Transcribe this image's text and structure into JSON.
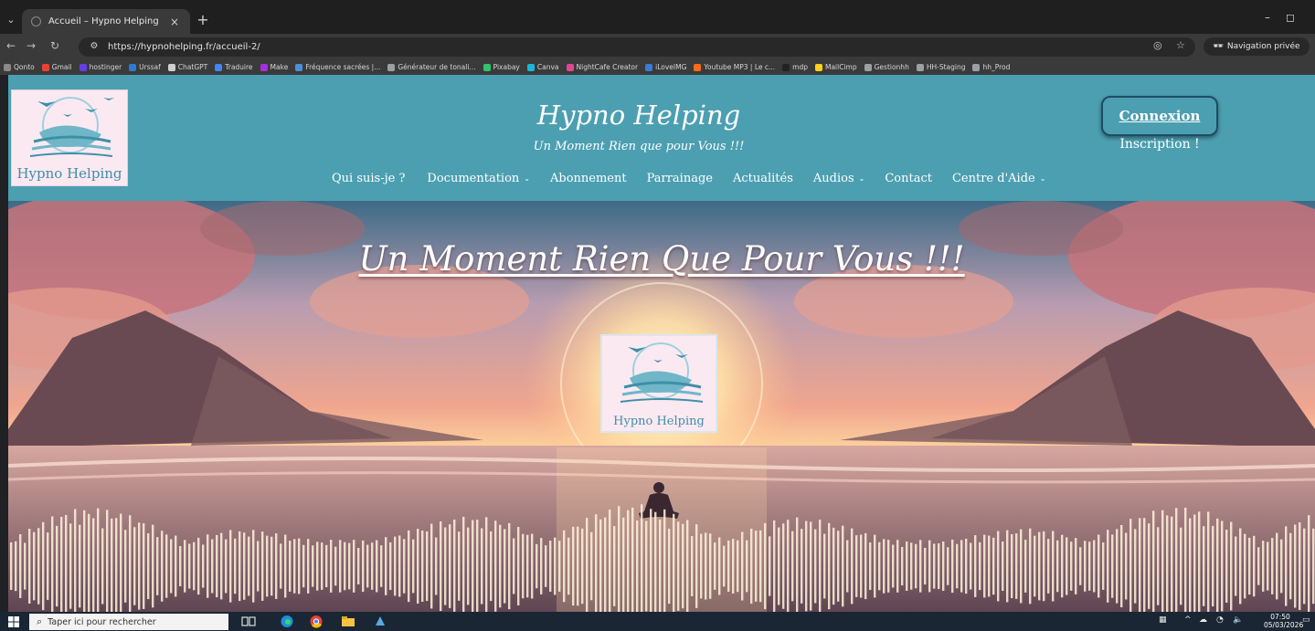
{
  "browser": {
    "tab_title": "Accueil – Hypno Helping",
    "tab_close": "×",
    "new_tab": "+",
    "url": "https://hypnohelping.fr/accueil-2/",
    "private_label": "Navigation privée",
    "minimize": "–",
    "restore": "◻",
    "bookmarks": [
      {
        "label": "Qonto",
        "color": "#8a8a8a"
      },
      {
        "label": "Gmail",
        "color": "#e94235"
      },
      {
        "label": "hostinger",
        "color": "#673de6"
      },
      {
        "label": "Urssaf",
        "color": "#2b7bd6"
      },
      {
        "label": "ChatGPT",
        "color": "#d0d0d0"
      },
      {
        "label": "Traduire",
        "color": "#4285f4"
      },
      {
        "label": "Make",
        "color": "#a62fe0"
      },
      {
        "label": "Fréquence sacrées |...",
        "color": "#4a90d9"
      },
      {
        "label": "Générateur de tonali...",
        "color": "#9aa0a6"
      },
      {
        "label": "Pixabay",
        "color": "#2ec66d"
      },
      {
        "label": "Canva",
        "color": "#19b7d6"
      },
      {
        "label": "NightCafe Creator",
        "color": "#e04595"
      },
      {
        "label": "iLoveIMG",
        "color": "#3a7bd5"
      },
      {
        "label": "Youtube MP3 | Le c...",
        "color": "#ff6a1a"
      },
      {
        "label": "mdp",
        "color": "#222222"
      },
      {
        "label": "MailCimp",
        "color": "#ffd21a"
      },
      {
        "label": "Gestionhh",
        "color": "#9aa0a6"
      },
      {
        "label": "HH-Staging",
        "color": "#9aa0a6"
      },
      {
        "label": "hh_Prod",
        "color": "#9aa0a6"
      }
    ]
  },
  "site": {
    "brand_title": "Hypno Helping",
    "brand_tagline": "Un Moment Rien que pour Vous !!!",
    "logo_text": "Hypno Helping",
    "nav": [
      {
        "label": "Qui suis-je ?",
        "dropdown": false
      },
      {
        "label": "Documentation",
        "dropdown": true
      },
      {
        "label": "Abonnement",
        "dropdown": false
      },
      {
        "label": "Parrainage",
        "dropdown": false
      },
      {
        "label": "Actualités",
        "dropdown": false
      },
      {
        "label": "Audios",
        "dropdown": true
      },
      {
        "label": "Contact",
        "dropdown": false
      },
      {
        "label": "Centre d'Aide",
        "dropdown": true
      }
    ],
    "connexion_label": "Connexion",
    "inscription_label": "Inscription !",
    "hero_title": "Un Moment Rien Que Pour Vous !!!",
    "hero_logo_text": "Hypno Helping",
    "colors": {
      "header_bg": "#4c9fb1",
      "logo_bg": "#fbe9f2",
      "logo_text": "#3e8fa6"
    }
  },
  "taskbar": {
    "search_placeholder": "Taper ici pour rechercher",
    "time": "07:50",
    "date": "05/03/2026"
  }
}
